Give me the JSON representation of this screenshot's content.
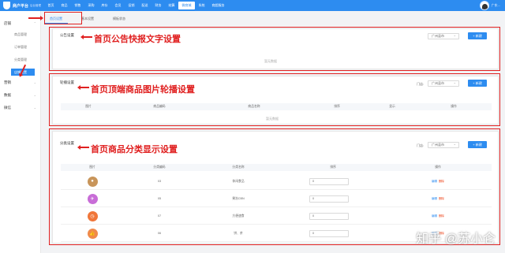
{
  "header": {
    "logo_title": "商户平台",
    "logo_sub": "后台管理",
    "nav": [
      "首页",
      "商品",
      "销售",
      "采购",
      "库存",
      "会员",
      "促销",
      "配送",
      "财务",
      "结算",
      "微商城",
      "系统",
      "商超服务"
    ],
    "active_nav": "微商城",
    "user_name": "广东..."
  },
  "sidebar": {
    "group_store": "店铺",
    "items": [
      "商品管理",
      "订单管理",
      "分类管理",
      "店铺设置"
    ],
    "active_item": "店铺设置",
    "group_marketing": "营销",
    "group_data": "数据",
    "group_wechat": "微信"
  },
  "tabs": [
    "首页设置",
    "基本设置",
    "模板状态"
  ],
  "active_tab": "首页设置",
  "notice": {
    "title": "公告设置",
    "select_value": "广州县市",
    "new_button": "+ 新建",
    "empty_text": "暂无数据"
  },
  "carousel": {
    "title": "轮播设置",
    "store_label": "门店:",
    "select_value": "广州县市",
    "new_button": "+ 新建",
    "columns": [
      "图片",
      "商品编码",
      "商品名称",
      "排序",
      "显示",
      "操作"
    ],
    "empty_text": "暂无数据"
  },
  "category": {
    "title": "分类设置",
    "store_label": "门店:",
    "select_value": "广州县市",
    "new_button": "+ 新建",
    "columns": [
      "图片",
      "分类编码",
      "分类名称",
      "排序",
      "操作"
    ],
    "rows": [
      {
        "code": "03",
        "name": "休闲食品",
        "sort": "0",
        "edit": "编辑",
        "del": "删除",
        "icon": "bowl-icon",
        "color": "#c8955a"
      },
      {
        "code": "05",
        "name": "果冻CBN",
        "sort": "0",
        "edit": "编辑",
        "del": "删除",
        "icon": "plane-icon",
        "color": "#c86dd7"
      },
      {
        "code": "07",
        "name": "方便速食",
        "sort": "0",
        "edit": "编辑",
        "del": "删除",
        "icon": "clock-icon",
        "color": "#f0763a"
      },
      {
        "code": "06",
        "name": "饼、茶",
        "sort": "0",
        "edit": "编辑",
        "del": "删除",
        "icon": "thumb-icon",
        "color": "#f08a4b"
      }
    ]
  },
  "annotations": {
    "notice": "首页公告快报文字设置",
    "carousel": "首页顶端商品图片轮播设置",
    "category": "首页商品分类显示设置"
  },
  "watermark": "知乎 @苏小仑",
  "colors": {
    "primary": "#2d8cf0",
    "annotation": "#e02020"
  }
}
